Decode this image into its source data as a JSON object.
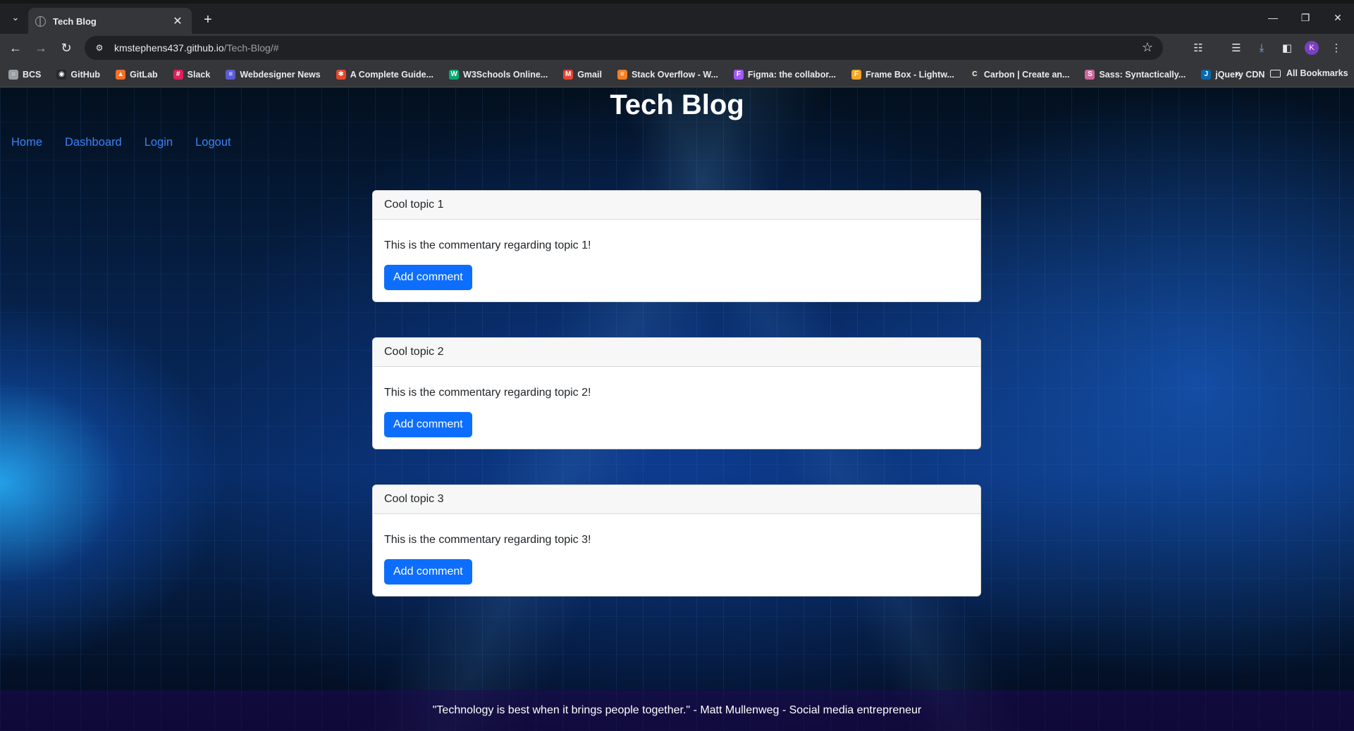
{
  "browser": {
    "tab": {
      "title": "Tech Blog"
    },
    "url": {
      "host": "kmstephens437.github.io",
      "path": "/Tech-Blog/#"
    },
    "profile_initial": "K",
    "bookmarks": [
      {
        "label": "BCS",
        "icon": "globe-icon",
        "color": "#9aa0a6"
      },
      {
        "label": "GitHub",
        "icon": "github-icon",
        "color": "#24292e"
      },
      {
        "label": "GitLab",
        "icon": "gitlab-icon",
        "color": "#fc6d26"
      },
      {
        "label": "Slack",
        "icon": "slack-icon",
        "color": "#e01e5a"
      },
      {
        "label": "Webdesigner News",
        "icon": "webdesigner-news-icon",
        "color": "#5b5bd6"
      },
      {
        "label": "A Complete Guide...",
        "icon": "css-tricks-icon",
        "color": "#e8452c"
      },
      {
        "label": "W3Schools Online...",
        "icon": "w3schools-icon",
        "color": "#04aa6d"
      },
      {
        "label": "Gmail",
        "icon": "gmail-icon",
        "color": "#ea4335"
      },
      {
        "label": "Stack Overflow - W...",
        "icon": "stackoverflow-icon",
        "color": "#f48024"
      },
      {
        "label": "Figma: the collabor...",
        "icon": "figma-icon",
        "color": "#a259ff"
      },
      {
        "label": "Frame Box - Lightw...",
        "icon": "framebox-icon",
        "color": "#f5a623"
      },
      {
        "label": "Carbon | Create an...",
        "icon": "carbon-icon",
        "color": "#3a3a3a"
      },
      {
        "label": "Sass: Syntactically...",
        "icon": "sass-icon",
        "color": "#cd6799"
      },
      {
        "label": "jQuery CDN",
        "icon": "jquery-icon",
        "color": "#0769ad"
      }
    ],
    "all_bookmarks": "All Bookmarks"
  },
  "site": {
    "title": "Tech Blog",
    "nav": [
      "Home",
      "Dashboard",
      "Login",
      "Logout"
    ],
    "posts": [
      {
        "title": "Cool topic 1",
        "body": "This is the commentary regarding topic 1!",
        "button": "Add comment"
      },
      {
        "title": "Cool topic 2",
        "body": "This is the commentary regarding topic 2!",
        "button": "Add comment"
      },
      {
        "title": "Cool topic 3",
        "body": "This is the commentary regarding topic 3!",
        "button": "Add comment"
      }
    ],
    "footer_quote": "\"Technology is best when it brings people together.\" - Matt Mullenweg - Social media entrepreneur",
    "accent_color": "#0d6efd"
  }
}
